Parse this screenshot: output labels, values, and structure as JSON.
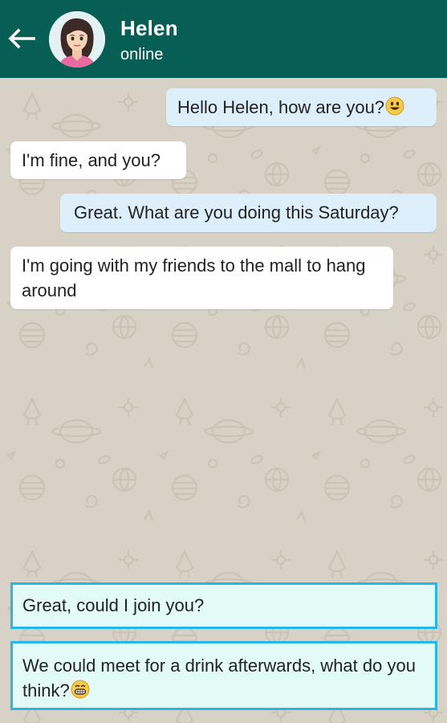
{
  "header": {
    "back_icon": "arrow-left-icon",
    "contact_name": "Helen",
    "contact_status": "online",
    "background_color": "#075e54"
  },
  "messages": [
    {
      "direction": "outgoing",
      "text": "Hello Helen, how are you?",
      "emoji": "smiling-face-icon"
    },
    {
      "direction": "incoming",
      "text": "I'm fine, and you?"
    },
    {
      "direction": "outgoing",
      "text": "Great. What are you doing this Saturday?"
    },
    {
      "direction": "incoming",
      "text": "I'm going with my friends to the mall to hang around"
    }
  ],
  "reply_options": [
    {
      "text": "Great, could I join you?"
    },
    {
      "text": "We could meet for a drink afterwards, what do you think?",
      "emoji": "grinning-face-icon"
    }
  ],
  "colors": {
    "outgoing_bubble": "#dceffa",
    "incoming_bubble": "#ffffff",
    "option_background": "#e3fbf6",
    "option_border": "#29b6e6",
    "wallpaper": "#d8d2c6"
  }
}
